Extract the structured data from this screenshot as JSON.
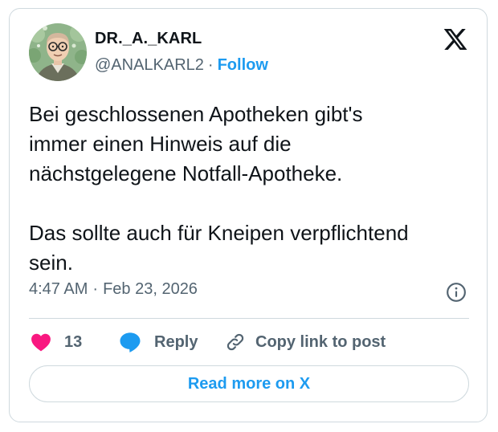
{
  "author": {
    "display_name": "DR._A._KARL",
    "handle": "@ANALKARL2",
    "separator": "·",
    "follow_label": "Follow"
  },
  "tweet": {
    "text": "Bei geschlossenen Apotheken gibt's\nimmer einen Hinweis auf die\nnächstgelegene Notfall-Apotheke.\n\nDas sollte auch für Kneipen verpflichtend\nsein.",
    "time": "4:47 AM",
    "separator": "·",
    "date": "Feb 23, 2026"
  },
  "actions": {
    "like_count": "13",
    "reply_label": "Reply",
    "copy_label": "Copy link to post"
  },
  "read_more_label": "Read more on X",
  "icons": {
    "brand": "x-logo-icon",
    "info": "info-icon",
    "like": "heart-icon",
    "reply": "speech-bubble-icon",
    "copy": "link-icon"
  },
  "colors": {
    "accent": "#1d9bf0",
    "like": "#f91880",
    "secondary_text": "#536471",
    "border": "#cfd9de"
  }
}
